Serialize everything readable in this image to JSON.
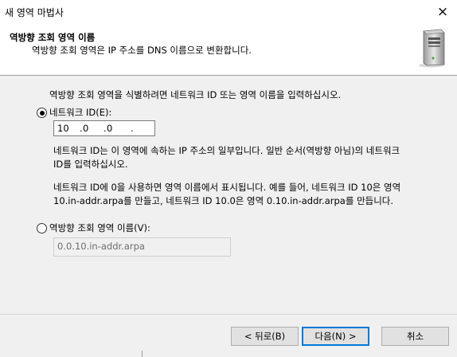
{
  "window": {
    "title": "새 영역 마법사",
    "close_icon": "×"
  },
  "header": {
    "title": "역방향 조회 영역 이름",
    "subtitle": "역방향 조회 영역은 IP 주소를 DNS 이름으로 변환합니다.",
    "icon": "server-icon"
  },
  "content": {
    "intro": "역방향 조회 영역을 식별하려면 네트워크 ID 또는 영역 이름을 입력하십시오.",
    "network_id_option": {
      "label": "네트워크 ID(E):",
      "selected": true,
      "octets": [
        "10",
        "0",
        "0",
        ""
      ],
      "separator": "."
    },
    "help1_line1": "네트워크 ID는 이 영역에 속하는 IP 주소의 일부입니다. 일반 순서(역방향 아님)의 네트워크",
    "help1_line2": "ID를 입력하십시오.",
    "help2_line1": "네트워크 ID에 0을 사용하면 영역 이름에서 표시됩니다. 예를 들어, 네트워크 ID 10은 영역",
    "help2_line2": "10.in-addr.arpa를 만들고, 네트워크 ID 10.0은 영역 0.10.in-addr.arpa를 만듭니다.",
    "zone_name_option": {
      "label": "역방향 조회 영역 이름(V):",
      "selected": false,
      "value": "0.0.10.in-addr.arpa"
    }
  },
  "buttons": {
    "back": "< 뒤로(B)",
    "next": "다음(N) >",
    "cancel": "취소"
  }
}
